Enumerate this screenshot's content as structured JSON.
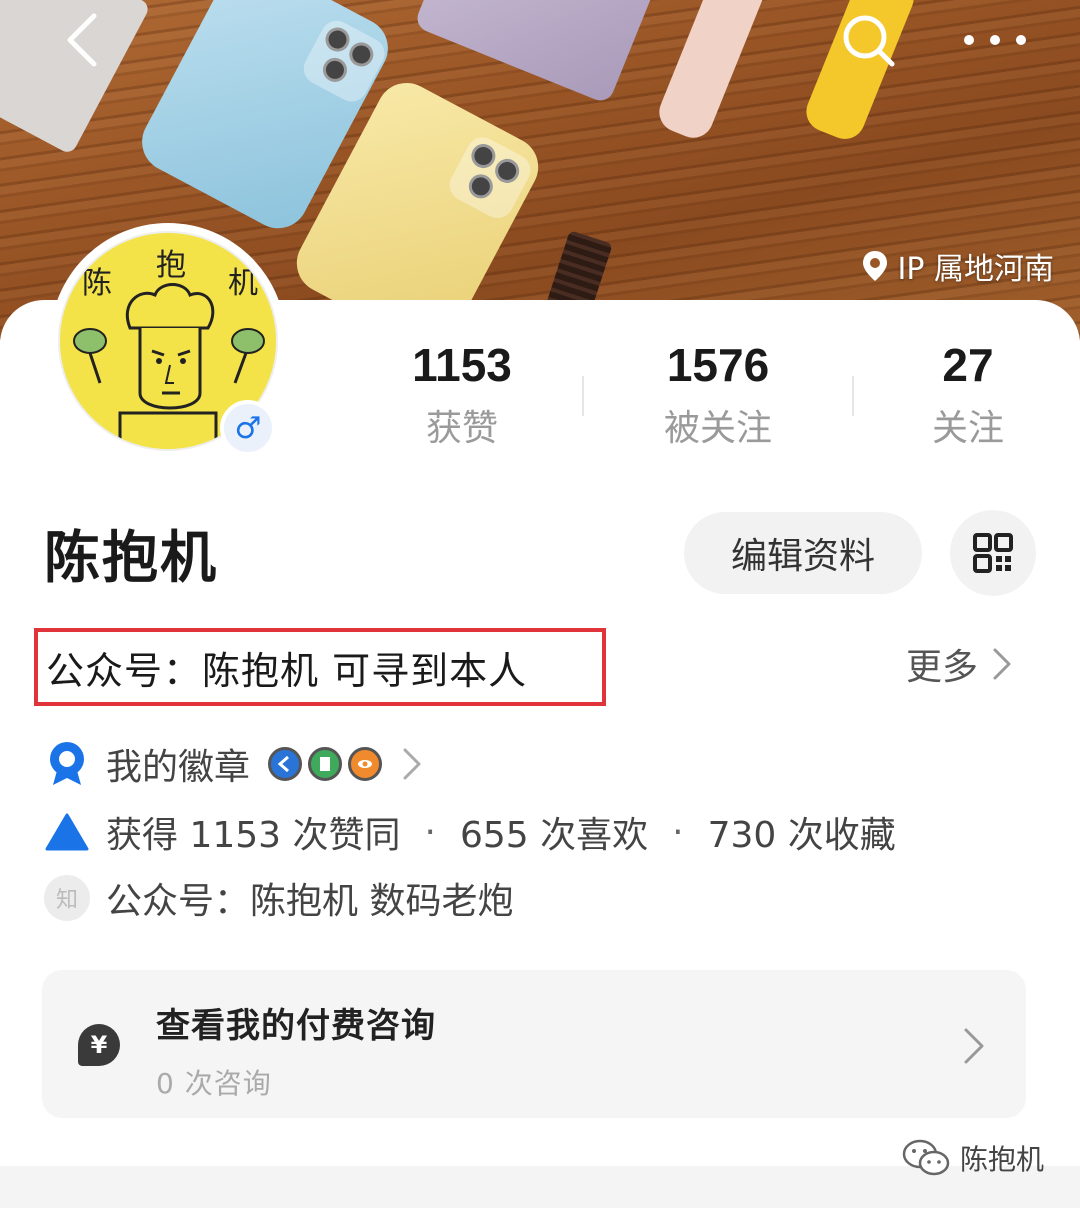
{
  "header": {
    "back_icon": "chevron-left-icon",
    "search_icon": "search-icon",
    "more_icon": "more-dots-icon",
    "ip_location": "IP 属地河南"
  },
  "profile": {
    "avatar_text": [
      "陈",
      "抱",
      "机"
    ],
    "gender": "♂",
    "name": "陈抱机",
    "stats": [
      {
        "value": "1153",
        "label": "获赞"
      },
      {
        "value": "1576",
        "label": "被关注"
      },
      {
        "value": "27",
        "label": "关注"
      }
    ],
    "edit_label": "编辑资料",
    "bio": "公众号：陈抱机 可寻到本人",
    "more_label": "更多",
    "badges_label": "我的徽章",
    "achievement": {
      "part1": "获得 1153 次赞同",
      "part2": "655 次喜欢",
      "part3": "730 次收藏",
      "separator": "·"
    },
    "zhi_label": "知",
    "intro": "公众号：陈抱机 数码老炮"
  },
  "consult": {
    "icon_text": "¥",
    "title": "查看我的付费咨询",
    "count": "0 次咨询"
  },
  "watermark": "陈抱机",
  "colors": {
    "accent_blue": "#1a74e8",
    "highlight_red": "#e0333a",
    "avatar_yellow": "#f3e348"
  }
}
